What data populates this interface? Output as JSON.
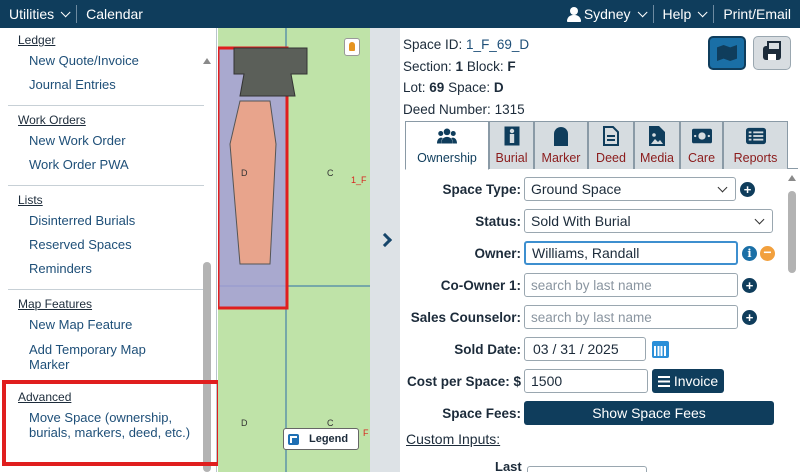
{
  "topbar": {
    "utilities": "Utilities",
    "calendar": "Calendar",
    "user": "Sydney",
    "help": "Help",
    "print_email": "Print/Email"
  },
  "menu": {
    "sections": [
      {
        "heading": "Ledger",
        "links": [
          "New Quote/Invoice",
          "Journal Entries"
        ]
      },
      {
        "heading": "Work Orders",
        "links": [
          "New Work Order",
          "Work Order PWA"
        ]
      },
      {
        "heading": "Lists",
        "links": [
          "Disinterred Burials",
          "Reserved Spaces",
          "Reminders"
        ]
      },
      {
        "heading": "Map Features",
        "links": [
          "New Map Feature",
          "Add Temporary Map Marker"
        ]
      },
      {
        "heading": "Advanced",
        "links": [
          "Move Space (ownership, burials, markers, deed, etc.)"
        ]
      }
    ]
  },
  "map": {
    "labels": [
      "D",
      "C",
      "1_F",
      "D",
      "C",
      "F"
    ],
    "legend": "Legend"
  },
  "space": {
    "id_label": "Space ID:",
    "id_value": "1_F_69_D",
    "section_label": "Section:",
    "section_value": "1",
    "block_label": "Block:",
    "block_value": "F",
    "lot_label": "Lot:",
    "lot_value": "69",
    "space_label": "Space:",
    "space_value": "D",
    "deed_label": "Deed Number:",
    "deed_value": "1315"
  },
  "tabs": [
    "Ownership",
    "Burial",
    "Marker",
    "Deed",
    "Media",
    "Care",
    "Reports"
  ],
  "form": {
    "space_type_label": "Space Type:",
    "space_type_value": "Ground Space",
    "status_label": "Status:",
    "status_value": "Sold With Burial",
    "owner_label": "Owner:",
    "owner_value": "Williams, Randall",
    "coowner_label": "Co-Owner 1:",
    "coowner_placeholder": "search by last name",
    "sales_label": "Sales Counselor:",
    "sales_placeholder": "search by last name",
    "sold_date_label": "Sold Date:",
    "sold_date_value": "03 / 31 / 2025",
    "cost_label": "Cost per Space: $",
    "cost_value": "1500",
    "invoice_button": "Invoice",
    "fees_label": "Space Fees:",
    "fees_button": "Show Space Fees",
    "custom_inputs": "Custom Inputs:",
    "last_label": "Last"
  },
  "colors": {
    "nav": "#0f3d5c",
    "accent_blue": "#1a6fa6",
    "highlight_red": "#e01e1e",
    "map_green": "#bfe3a8"
  }
}
